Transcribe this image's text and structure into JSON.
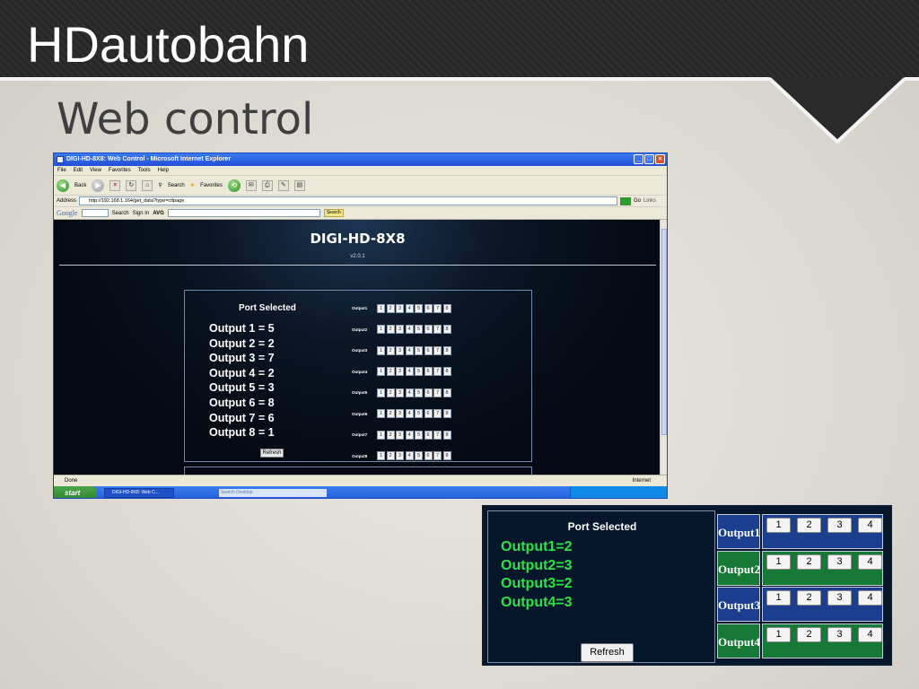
{
  "slide": {
    "title": "HDautobahn",
    "subtitle": "Web control"
  },
  "browser": {
    "window_title": "DIGI-HD-8X8: Web Control - Microsoft Internet Explorer",
    "menu": [
      "File",
      "Edit",
      "View",
      "Favorites",
      "Tools",
      "Help"
    ],
    "toolbar": {
      "back": "Back",
      "search": "Search",
      "favorites": "Favorites"
    },
    "address_label": "Address",
    "address": "http://192.168.1.164/get_data?type=ctlpage",
    "go": "Go",
    "links": "Links",
    "google": {
      "logo": "Google",
      "search": "Search",
      "sign_in": "Sign In",
      "avg": "AVG",
      "search_button": "Search"
    },
    "status": "Done",
    "zone": "Internet",
    "taskbar": {
      "start": "start",
      "task": "DIGI-HD-8X8: Web C...",
      "search": "Search Desktop"
    }
  },
  "device": {
    "name": "DIGI-HD-8X8",
    "version": "v2.0.1",
    "port_selected": "Port Selected",
    "status": [
      "Output 1 = 5",
      "Output 2 = 2",
      "Output 3 = 7",
      "Output 4 = 2",
      "Output 5 = 3",
      "Output 6 = 8",
      "Output 7 = 6",
      "Output 8 = 1"
    ],
    "refresh": "Refresh",
    "outputs": [
      "Output1",
      "Output2",
      "Output3",
      "Output4",
      "Output5",
      "Output6",
      "Output7",
      "Output8"
    ],
    "inputs": [
      "1",
      "2",
      "3",
      "4",
      "5",
      "6",
      "7",
      "8"
    ]
  },
  "panel4": {
    "port_selected": "Port Selected",
    "status": [
      "Output1=2",
      "Output2=3",
      "Output3=2",
      "Output4=3"
    ],
    "refresh": "Refresh",
    "outputs": [
      {
        "label": "Output1",
        "color": "#1b3f8e"
      },
      {
        "label": "Output2",
        "color": "#167a36"
      },
      {
        "label": "Output3",
        "color": "#1b3f8e"
      },
      {
        "label": "Output4",
        "color": "#167a36"
      }
    ],
    "inputs": [
      "1",
      "2",
      "3",
      "4"
    ],
    "status_color": "#2be24a"
  }
}
